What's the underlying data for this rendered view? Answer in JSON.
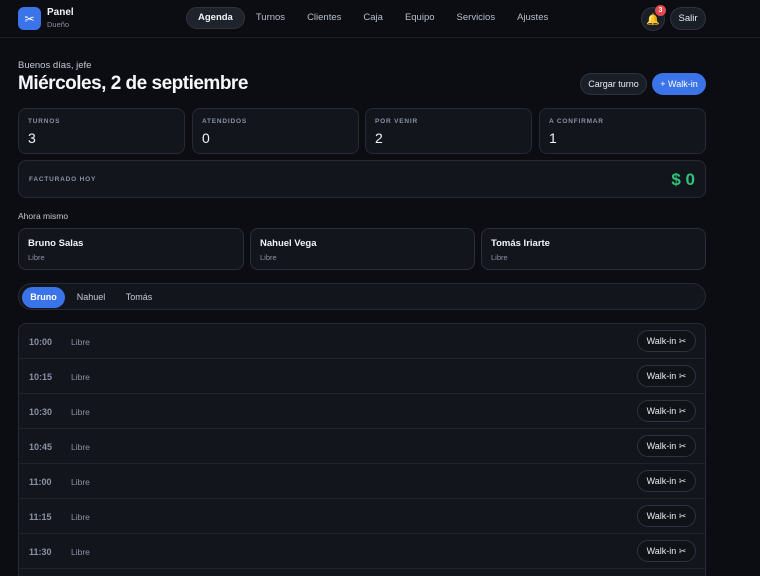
{
  "brand": {
    "title": "Panel",
    "subtitle": "Dueño",
    "icon": "scissors-icon"
  },
  "nav": [
    "Agenda",
    "Turnos",
    "Clientes",
    "Caja",
    "Equipo",
    "Servicios",
    "Ajustes"
  ],
  "nav_active": "Agenda",
  "notifications": {
    "icon": "bell-icon",
    "count": "3"
  },
  "logout_label": "Salir",
  "header": {
    "greeting": "Buenos días, jefe",
    "date": "Miércoles, 2 de septiembre",
    "cargar_turno": "Cargar turno",
    "walkin": "+ Walk-in"
  },
  "stats": [
    {
      "label": "TURNOS",
      "value": "3"
    },
    {
      "label": "ATENDIDOS",
      "value": "0"
    },
    {
      "label": "POR VENIR",
      "value": "2"
    },
    {
      "label": "A CONFIRMAR",
      "value": "1"
    }
  ],
  "revenue": {
    "label": "FACTURADO HOY",
    "value": "$ 0"
  },
  "now": {
    "label": "Ahora mismo",
    "barbers": [
      {
        "name": "Bruno Salas",
        "status": "Libre"
      },
      {
        "name": "Nahuel Vega",
        "status": "Libre"
      },
      {
        "name": "Tomás Iriarte",
        "status": "Libre"
      }
    ]
  },
  "tabs": [
    "Bruno",
    "Nahuel",
    "Tomás"
  ],
  "tab_active": "Bruno",
  "slots": [
    {
      "time": "10:00",
      "status": "Libre",
      "action": "Walk-in ✂"
    },
    {
      "time": "10:15",
      "status": "Libre",
      "action": "Walk-in ✂"
    },
    {
      "time": "10:30",
      "status": "Libre",
      "action": "Walk-in ✂"
    },
    {
      "time": "10:45",
      "status": "Libre",
      "action": "Walk-in ✂"
    },
    {
      "time": "11:00",
      "status": "Libre",
      "action": "Walk-in ✂"
    },
    {
      "time": "11:15",
      "status": "Libre",
      "action": "Walk-in ✂"
    },
    {
      "time": "11:30",
      "status": "Libre",
      "action": "Walk-in ✂"
    },
    {
      "time": "",
      "status": "",
      "action": ""
    }
  ],
  "colors": {
    "accent": "#3b74e8",
    "money": "#2fc27a",
    "badge": "#e5484d",
    "background": "#0b0d12"
  }
}
